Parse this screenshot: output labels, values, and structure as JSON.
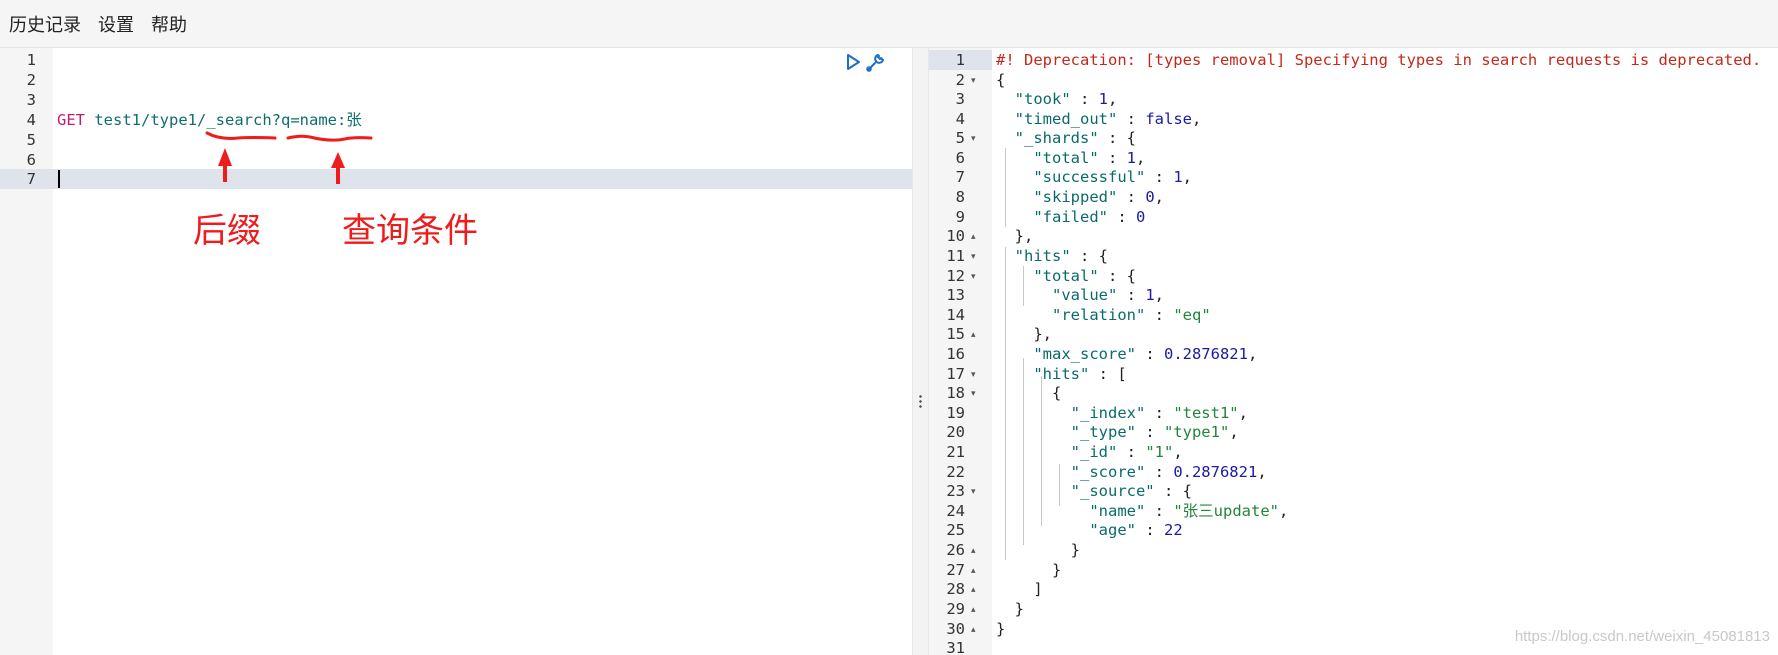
{
  "menu": {
    "history": "历史记录",
    "settings": "设置",
    "help": "帮助"
  },
  "editor": {
    "line_numbers": [
      "1",
      "2",
      "3",
      "4",
      "5",
      "6",
      "7"
    ],
    "request": {
      "method": "GET",
      "path": "test1/type1/",
      "suffix": "_search",
      "query": "?q=name:张"
    }
  },
  "annotations": {
    "suffix_label": "后缀",
    "query_label": "查询条件",
    "color": "#ee1c1c"
  },
  "response": {
    "line_numbers": [
      "1",
      "2",
      "3",
      "4",
      "5",
      "6",
      "7",
      "8",
      "9",
      "10",
      "11",
      "12",
      "13",
      "14",
      "15",
      "16",
      "17",
      "18",
      "19",
      "20",
      "21",
      "22",
      "23",
      "24",
      "25",
      "26",
      "27",
      "28",
      "29",
      "30",
      "31"
    ],
    "deprecation": "#! Deprecation: [types removal] Specifying types in search requests is deprecated.",
    "took": "1",
    "timed_out": "false",
    "shards": {
      "total": "1",
      "successful": "1",
      "skipped": "0",
      "failed": "0"
    },
    "hits_total": {
      "value": "1",
      "relation": "\"eq\""
    },
    "max_score": "0.2876821",
    "doc": {
      "index": "\"test1\"",
      "type": "\"type1\"",
      "id": "\"1\"",
      "score": "0.2876821"
    },
    "source": {
      "name": "\"张三update\"",
      "age": "22"
    }
  },
  "watermark": "https://blog.csdn.net/weixin_45081813",
  "icons": [
    "play-icon",
    "wrench-icon",
    "drag-handle-icon"
  ],
  "colors": {
    "method": "#c41a6e",
    "string": "#22863a",
    "number": "#1a1aa6",
    "comment": "#c4281b",
    "active_line": "#dfe4ec"
  }
}
